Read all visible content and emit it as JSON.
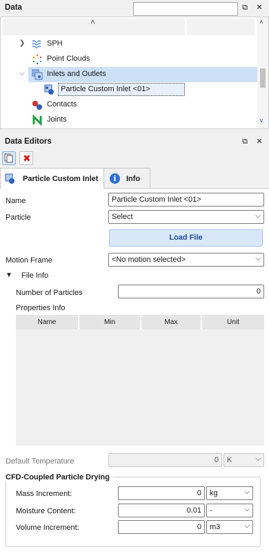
{
  "data_panel": {
    "title": "Data",
    "search_placeholder": "",
    "tree": [
      {
        "label": "SPH",
        "icon": "sph-waves-icon",
        "color": "#4a8fd6",
        "expandable": true,
        "expanded": false
      },
      {
        "label": "Point Clouds",
        "icon": "point-cloud-icon",
        "color": "#e07020",
        "expandable": false
      },
      {
        "label": "Inlets and Outlets",
        "icon": "inlets-outlets-icon",
        "color": "#4a78c8",
        "expandable": true,
        "expanded": true,
        "highlighted": true
      },
      {
        "label": "Particle Custom Inlet <01>",
        "icon": "particle-inlet-icon",
        "color": "#3060b8",
        "selected": true
      },
      {
        "label": "Contacts",
        "icon": "contacts-icon",
        "color": "#d03030"
      },
      {
        "label": "Joints",
        "icon": "joints-icon",
        "color": "#20a040"
      }
    ]
  },
  "editor_panel": {
    "title": "Data Editors",
    "tabs": [
      {
        "label": "Particle Custom Inlet",
        "active": true
      },
      {
        "label": "Info",
        "active": false
      }
    ],
    "fields": {
      "name_label": "Name",
      "name_value": "Particle Custom Inlet <01>",
      "particle_label": "Particle",
      "particle_value": "Select",
      "load_file_label": "Load File",
      "motion_frame_label": "Motion Frame",
      "motion_frame_value": "<No motion selected>",
      "file_info_label": "File Info",
      "num_particles_label": "Number of Particles",
      "num_particles_value": "0",
      "properties_info_label": "Properties Info",
      "columns": [
        "Name",
        "Min",
        "Max",
        "Unit"
      ],
      "default_temp_label": "Default Temperature",
      "default_temp_value": "0",
      "default_temp_unit": "K"
    },
    "drying": {
      "title": "CFD-Coupled Particle Drying",
      "rows": [
        {
          "label": "Mass Increment:",
          "value": "0",
          "unit": "kg"
        },
        {
          "label": "Moisture Content:",
          "value": "0.01",
          "unit": "-"
        },
        {
          "label": "Volume Increment:",
          "value": "0",
          "unit": "m3"
        }
      ]
    }
  }
}
